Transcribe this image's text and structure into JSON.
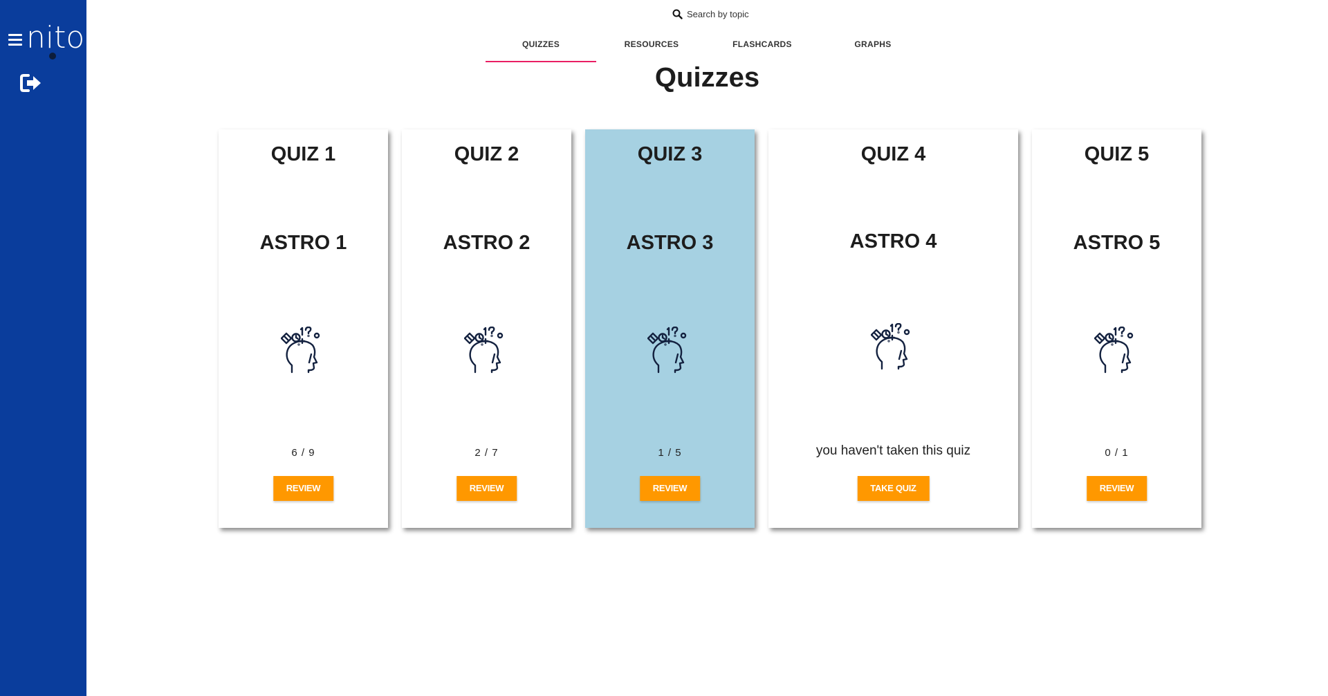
{
  "app": {
    "logo_text": "nito",
    "menu_icon": "hamburger-icon",
    "logout_icon": "sign-out-icon"
  },
  "search": {
    "icon": "search-icon",
    "label": "Search by topic"
  },
  "tabs": [
    {
      "label": "QUIZZES",
      "active": true
    },
    {
      "label": "RESOURCES",
      "active": false
    },
    {
      "label": "FLASHCARDS",
      "active": false
    },
    {
      "label": "GRAPHS",
      "active": false
    }
  ],
  "page_title": "Quizzes",
  "colors": {
    "sidebar": "#0a3d9c",
    "accent_underline": "#e91e63",
    "button": "#ff9800",
    "highlight_card": "#a6d1e2"
  },
  "cards": [
    {
      "quiz": "QUIZ 1",
      "topic": "ASTRO 1",
      "icon": "head-brain-icon",
      "score": "6 / 9",
      "button": "REVIEW",
      "highlighted": false
    },
    {
      "quiz": "QUIZ 2",
      "topic": "ASTRO 2",
      "icon": "head-brain-icon",
      "score": "2 / 7",
      "button": "REVIEW",
      "highlighted": false
    },
    {
      "quiz": "QUIZ 3",
      "topic": "ASTRO 3",
      "icon": "head-brain-icon",
      "score": "1 / 5",
      "button": "REVIEW",
      "highlighted": true
    },
    {
      "quiz": "QUIZ 4",
      "topic": "ASTRO 4",
      "icon": "head-brain-icon",
      "score": "you haven't taken this quiz",
      "button": "TAKE QUIZ",
      "highlighted": false
    },
    {
      "quiz": "QUIZ 5",
      "topic": "ASTRO 5",
      "icon": "head-brain-icon",
      "score": "0 / 1",
      "button": "REVIEW",
      "highlighted": false
    }
  ]
}
